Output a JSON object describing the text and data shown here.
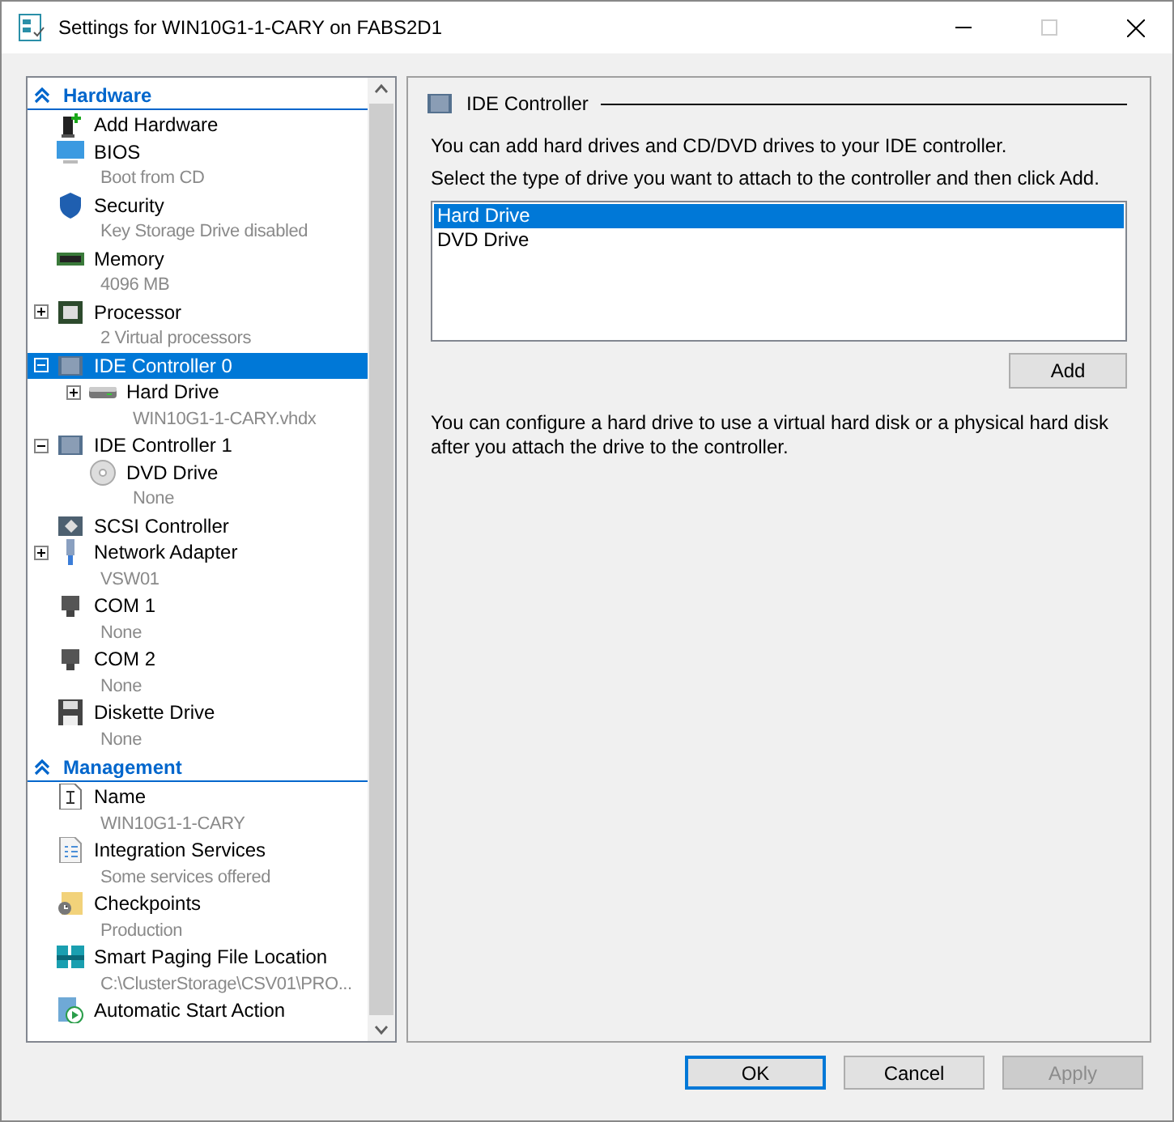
{
  "window": {
    "title": "Settings for WIN10G1-1-CARY on FABS2D1"
  },
  "sidebar": {
    "sections": [
      {
        "title": "Hardware",
        "expanded": true,
        "items": [
          {
            "kind": "addhw",
            "name": "Add Hardware",
            "selected": false
          },
          {
            "kind": "bios",
            "name": "BIOS",
            "detail": "Boot from CD",
            "selected": false
          },
          {
            "kind": "security",
            "name": "Security",
            "detail": "Key Storage Drive disabled",
            "selected": false
          },
          {
            "kind": "memory",
            "name": "Memory",
            "detail": "4096 MB",
            "selected": false
          },
          {
            "kind": "processor",
            "name": "Processor",
            "detail": "2 Virtual processors",
            "expanded": false,
            "selected": false
          },
          {
            "kind": "controller",
            "name": "IDE Controller 0",
            "expanded": true,
            "selected": true,
            "children": [
              {
                "kind": "harddrive",
                "name": "Hard Drive",
                "detail": "WIN10G1-1-CARY.vhdx",
                "expanded": false,
                "selected": false
              }
            ]
          },
          {
            "kind": "controller",
            "name": "IDE Controller 1",
            "expanded": true,
            "selected": false,
            "children": [
              {
                "kind": "dvd",
                "name": "DVD Drive",
                "detail": "None",
                "selected": false
              }
            ]
          },
          {
            "kind": "scsi",
            "name": "SCSI Controller",
            "selected": false
          },
          {
            "kind": "network",
            "name": "Network Adapter",
            "detail": "VSW01",
            "expanded": false,
            "selected": false
          },
          {
            "kind": "com",
            "name": "COM 1",
            "detail": "None",
            "selected": false
          },
          {
            "kind": "com",
            "name": "COM 2",
            "detail": "None",
            "selected": false
          },
          {
            "kind": "diskette",
            "name": "Diskette Drive",
            "detail": "None",
            "selected": false
          }
        ]
      },
      {
        "title": "Management",
        "expanded": true,
        "items": [
          {
            "kind": "name",
            "name": "Name",
            "detail": "WIN10G1-1-CARY",
            "selected": false
          },
          {
            "kind": "integration",
            "name": "Integration Services",
            "detail": "Some services offered",
            "selected": false
          },
          {
            "kind": "checkpoints",
            "name": "Checkpoints",
            "detail": "Production",
            "selected": false
          },
          {
            "kind": "paging",
            "name": "Smart Paging File Location",
            "detail": "C:\\ClusterStorage\\CSV01\\PRO...",
            "selected": false
          },
          {
            "kind": "autostart",
            "name": "Automatic Start Action",
            "selected": false
          }
        ]
      }
    ]
  },
  "detail": {
    "title": "IDE Controller",
    "intro": "You can add hard drives and CD/DVD drives to your IDE controller.",
    "instruction": "Select the type of drive you want to attach to the controller and then click Add.",
    "drive_types": [
      {
        "label": "Hard Drive",
        "selected": true
      },
      {
        "label": "DVD Drive",
        "selected": false
      }
    ],
    "add_button": "Add",
    "note": "You can configure a hard drive to use a virtual hard disk or a physical hard disk after you attach the drive to the controller."
  },
  "buttons": [
    {
      "label": "OK",
      "default": true,
      "disabled": false
    },
    {
      "label": "Cancel",
      "default": false,
      "disabled": false
    },
    {
      "label": "Apply",
      "default": false,
      "disabled": true
    }
  ]
}
